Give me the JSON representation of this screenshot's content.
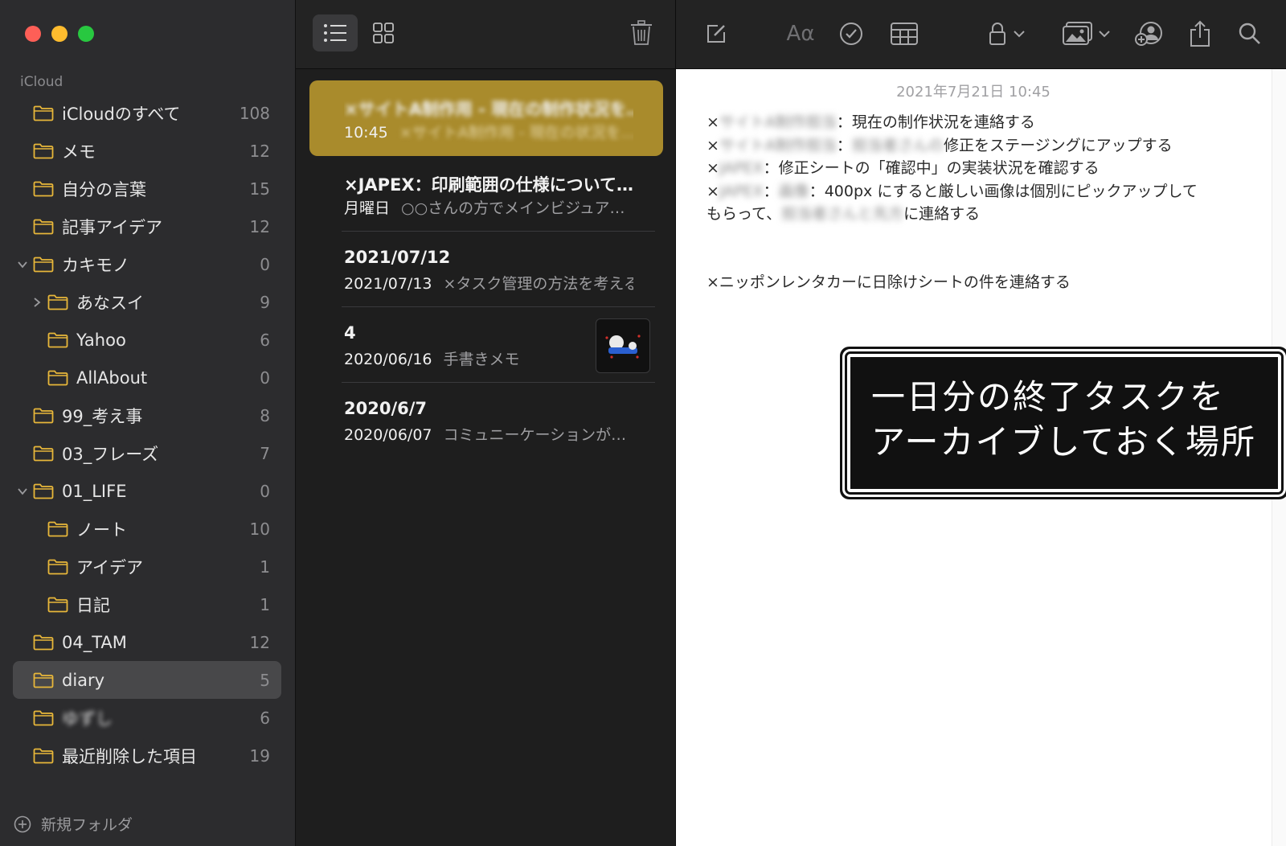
{
  "window": {
    "traffic_lights": [
      "close",
      "minimize",
      "zoom"
    ]
  },
  "sidebar": {
    "section": "iCloud",
    "folders": [
      {
        "name": "iCloudのすべて",
        "count": "108",
        "level": 0,
        "disclosure": "none"
      },
      {
        "name": "メモ",
        "count": "12",
        "level": 0,
        "disclosure": "none"
      },
      {
        "name": "自分の言葉",
        "count": "15",
        "level": 0,
        "disclosure": "none"
      },
      {
        "name": "記事アイデア",
        "count": "12",
        "level": 0,
        "disclosure": "none"
      },
      {
        "name": "カキモノ",
        "count": "0",
        "level": 0,
        "disclosure": "open"
      },
      {
        "name": "あなスイ",
        "count": "9",
        "level": 1,
        "disclosure": "closed"
      },
      {
        "name": "Yahoo",
        "count": "6",
        "level": 1,
        "disclosure": "none"
      },
      {
        "name": "AllAbout",
        "count": "0",
        "level": 1,
        "disclosure": "none"
      },
      {
        "name": "99_考え事",
        "count": "8",
        "level": 0,
        "disclosure": "none"
      },
      {
        "name": "03_フレーズ",
        "count": "7",
        "level": 0,
        "disclosure": "none"
      },
      {
        "name": "01_LIFE",
        "count": "0",
        "level": 0,
        "disclosure": "open"
      },
      {
        "name": "ノート",
        "count": "10",
        "level": 1,
        "disclosure": "none"
      },
      {
        "name": "アイデア",
        "count": "1",
        "level": 1,
        "disclosure": "none"
      },
      {
        "name": "日記",
        "count": "1",
        "level": 1,
        "disclosure": "none"
      },
      {
        "name": "04_TAM",
        "count": "12",
        "level": 0,
        "disclosure": "none"
      },
      {
        "name": "diary",
        "count": "5",
        "level": 0,
        "disclosure": "none",
        "selected": true
      },
      {
        "name": "ゆずし",
        "count": "6",
        "level": 0,
        "disclosure": "none",
        "blurred": true
      },
      {
        "name": "最近削除した項目",
        "count": "19",
        "level": 0,
        "disclosure": "none"
      }
    ],
    "new_folder_label": "新規フォルダ"
  },
  "notes_list": {
    "toolbar": {
      "list_view_icon": "list-icon",
      "gallery_view_icon": "grid-icon",
      "delete_icon": "trash-icon"
    },
    "notes": [
      {
        "title": "×サイトA制作用 - 現在の制作状況を…",
        "date": "10:45",
        "preview": "×サイトA制作用 - 現在の状況を…",
        "selected": true,
        "blurred_title": true
      },
      {
        "title": "×JAPEX：印刷範囲の仕様について…",
        "date": "月曜日",
        "preview": "○○さんの方でメインビジュア…"
      },
      {
        "title": "2021/07/12",
        "date": "2021/07/13",
        "preview": "×タスク管理の方法を考える"
      },
      {
        "title": "4",
        "date": "2020/06/16",
        "preview": "手書きメモ",
        "has_thumbnail": true
      },
      {
        "title": "2020/6/7",
        "date": "2020/06/07",
        "preview": "コミュニーケーションが…"
      }
    ]
  },
  "editor": {
    "toolbar_icons": [
      "compose-icon",
      "format-icon",
      "checklist-icon",
      "table-icon",
      "lock-icon",
      "media-icon",
      "collaborate-icon",
      "share-icon",
      "search-icon"
    ],
    "format_label": "Aα",
    "date": "2021年7月21日 10:45",
    "lines": [
      {
        "prefix": "×",
        "blurred": "サイトA制作担当",
        "text": "：現在の制作状況を連絡する"
      },
      {
        "prefix": "×",
        "blurred": "サイトA制作担当",
        "text": "：",
        "blurred2": "担当者さんの",
        "text2": "修正をステージングにアップする"
      },
      {
        "prefix": "×",
        "blurred": "JAPEX",
        "text": "：修正シートの「確認中」の実装状況を確認する"
      },
      {
        "prefix": "×",
        "blurred": "JAPEX",
        "text": "：",
        "blurred2": "画像",
        "text2": "：400px にすると厳しい画像は個別にピックアップして"
      },
      {
        "prefix": "",
        "blurred": "",
        "text": "もらって、",
        "blurred2": "担当者さんと先方",
        "text2": "に連絡する"
      }
    ],
    "last_line": "×ニッポンレンタカーに日除けシートの件を連絡する"
  },
  "callout": {
    "text": "一日分の終了タスクを\nアーカイブしておく場所"
  },
  "colors": {
    "sidebar_bg": "#2c2c2e",
    "list_bg": "#1e1e1e",
    "selected_note": "#a98b2c",
    "folder_icon": "#e8b73a",
    "editor_bg": "#ffffff"
  }
}
